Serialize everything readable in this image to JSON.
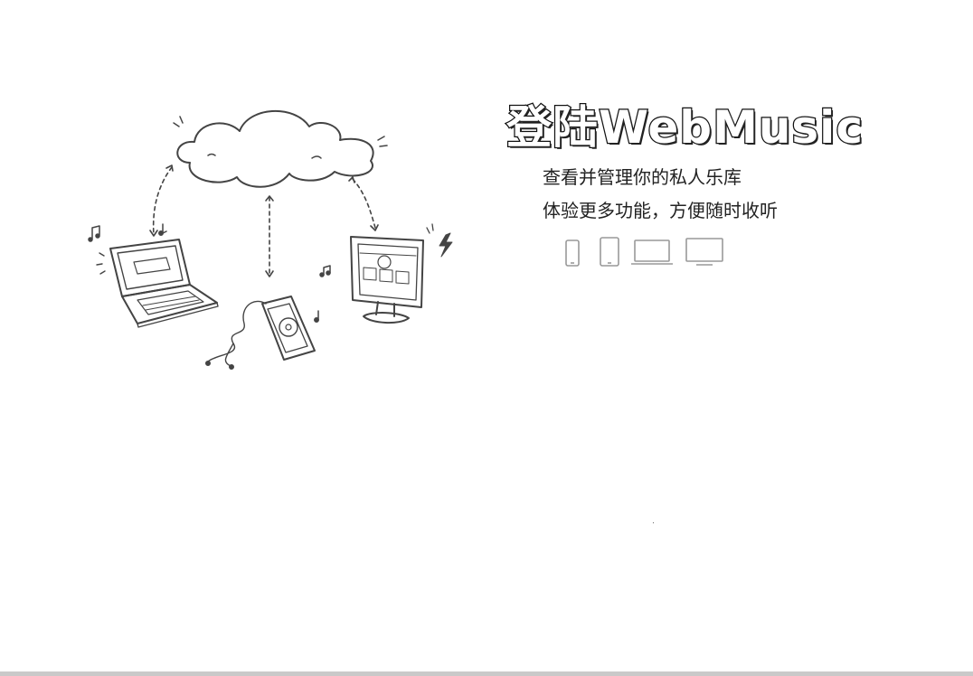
{
  "promo": {
    "title": "登陆WebMusic",
    "tagline_1": "查看并管理你的私人乐库",
    "tagline_2": "体验更多功能，方便随时收听"
  },
  "illustration": {
    "description_icons": [
      "cloud-icon",
      "laptop-icon",
      "music-player-icon",
      "desktop-monitor-icon",
      "music-note-icon",
      "lightning-icon"
    ]
  },
  "device_icons": [
    "phone-icon",
    "tablet-icon",
    "laptop-icon",
    "monitor-icon"
  ],
  "colors": {
    "background": "#ffffff",
    "text": "#222222",
    "sketch": "#444444",
    "device_icons": "#999999",
    "bottom_bar": "#c9c9c9"
  }
}
